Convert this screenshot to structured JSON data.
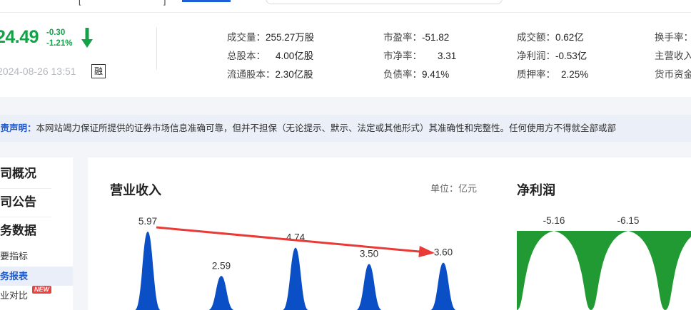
{
  "quote": {
    "price": "24.49",
    "change": "-0.30",
    "change_pct": "-1.21%",
    "datetime": "2024-08-26 13:51",
    "margin_badge": "融",
    "color_down": "#13a248"
  },
  "stats": [
    {
      "label": "成交量：",
      "value": "255.27万股"
    },
    {
      "label": "市盈率：",
      "value": "-51.82"
    },
    {
      "label": "成交额：",
      "value": "0.62亿"
    },
    {
      "label": "换手率：",
      "value": ""
    },
    {
      "label": "总股本：",
      "value": "4.00亿股"
    },
    {
      "label": "市净率：",
      "value": "3.31"
    },
    {
      "label": "净利润：",
      "value": "-0.53亿"
    },
    {
      "label": "主营收入",
      "value": ""
    },
    {
      "label": "流通股本：",
      "value": "2.30亿股"
    },
    {
      "label": "负债率：",
      "value": "9.41%"
    },
    {
      "label": "质押率：",
      "value": "2.25%"
    },
    {
      "label": "货币资金",
      "value": ""
    }
  ],
  "disclaimer": {
    "title": "免责声明：",
    "text": "本网站竭力保证所提供的证券市场信息准确可靠，但并不担保（无论提示、默示、法定或其他形式）其准确性和完整性。任何使用方不得就全部或部"
  },
  "sidebar": {
    "items": [
      {
        "label": "公司概况"
      },
      {
        "label": "公司公告"
      },
      {
        "label": "财务数据"
      },
      {
        "label": "主要指标"
      },
      {
        "label": "财务报表"
      },
      {
        "label": "行业对比"
      }
    ],
    "new_badge": "NEW"
  },
  "charts": {
    "revenue_title": "营业收入",
    "unit": "单位：亿元",
    "profit_title": "净利润"
  },
  "chart_data": [
    {
      "type": "area",
      "title": "营业收入",
      "unit": "单位：亿元",
      "values": [
        5.97,
        2.59,
        4.74,
        3.5,
        3.6
      ],
      "labels": [
        "5.97",
        "2.59",
        "4.74",
        "3.50",
        "3.60"
      ],
      "color": "#0b4fc6",
      "annotation": {
        "type": "arrow",
        "from_index": 0,
        "to_index": 4,
        "color": "#e93a36"
      }
    },
    {
      "type": "area",
      "title": "净利润",
      "values": [
        -5.16,
        -6.15
      ],
      "labels": [
        "-5.16",
        "-6.15"
      ],
      "color": "#219a34"
    }
  ]
}
